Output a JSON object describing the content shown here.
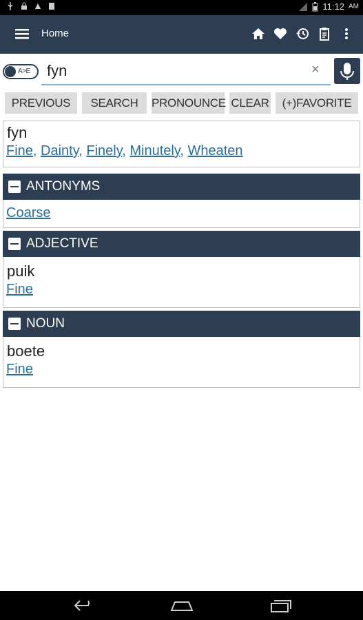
{
  "status_bar": {
    "time": "11:12",
    "ampm": "AM"
  },
  "app_bar": {
    "title": "Home",
    "icons": [
      "menu-icon",
      "home-icon",
      "heart-icon",
      "history-icon",
      "clipboard-icon",
      "overflow-icon"
    ]
  },
  "search": {
    "toggle_label": "A>E",
    "value": "fyn",
    "clear_label": "×"
  },
  "buttons": {
    "previous": "PREVIOUS",
    "search": "SEARCH",
    "pronounce": "PRONOUNCE",
    "clear": "CLEAR",
    "favorite": "(+)FAVORITE"
  },
  "result": {
    "word": "fyn",
    "translations": [
      "Fine",
      "Dainty",
      "Finely",
      "Minutely",
      "Wheaten"
    ]
  },
  "sections": [
    {
      "header": "ANTONYMS",
      "word": "",
      "link": "Coarse"
    },
    {
      "header": "ADJECTIVE",
      "word": "puik",
      "link": "Fine"
    },
    {
      "header": "NOUN",
      "word": "boete",
      "link": "Fine"
    }
  ],
  "colors": {
    "primary": "#2e3e52",
    "link": "#2b6d9a",
    "button_bg": "#dcdcdc"
  }
}
